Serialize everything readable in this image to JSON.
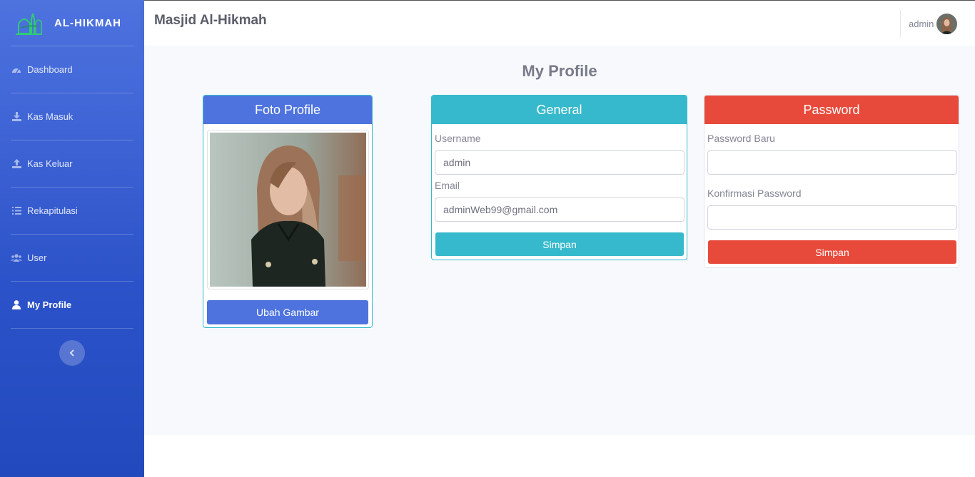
{
  "brand": {
    "name": "AL-HIKMAH"
  },
  "sidebar": {
    "items": [
      {
        "label": "Dashboard",
        "icon": "tachometer-icon"
      },
      {
        "label": "Kas Masuk",
        "icon": "download-icon"
      },
      {
        "label": "Kas Keluar",
        "icon": "upload-icon"
      },
      {
        "label": "Rekapitulasi",
        "icon": "list-icon"
      },
      {
        "label": "User",
        "icon": "users-icon"
      },
      {
        "label": "My Profile",
        "icon": "user-icon",
        "active": true
      }
    ],
    "toggle_icon": "chevron-left-icon"
  },
  "topbar": {
    "title": "Masjid Al-Hikmah",
    "username": "admin"
  },
  "page": {
    "title": "My Profile"
  },
  "photo_card": {
    "title": "Foto Profile",
    "button": "Ubah Gambar"
  },
  "general_card": {
    "title": "General",
    "username_label": "Username",
    "username_value": "admin",
    "email_label": "Email",
    "email_value": "adminWeb99@gmail.com",
    "button": "Simpan"
  },
  "password_card": {
    "title": "Password",
    "new_label": "Password Baru",
    "new_value": "",
    "confirm_label": "Konfirmasi Password",
    "confirm_value": "",
    "button": "Simpan"
  },
  "colors": {
    "primary": "#4e73df",
    "info": "#36b9cc",
    "danger": "#e74a3b",
    "background": "#f8f9fc"
  }
}
